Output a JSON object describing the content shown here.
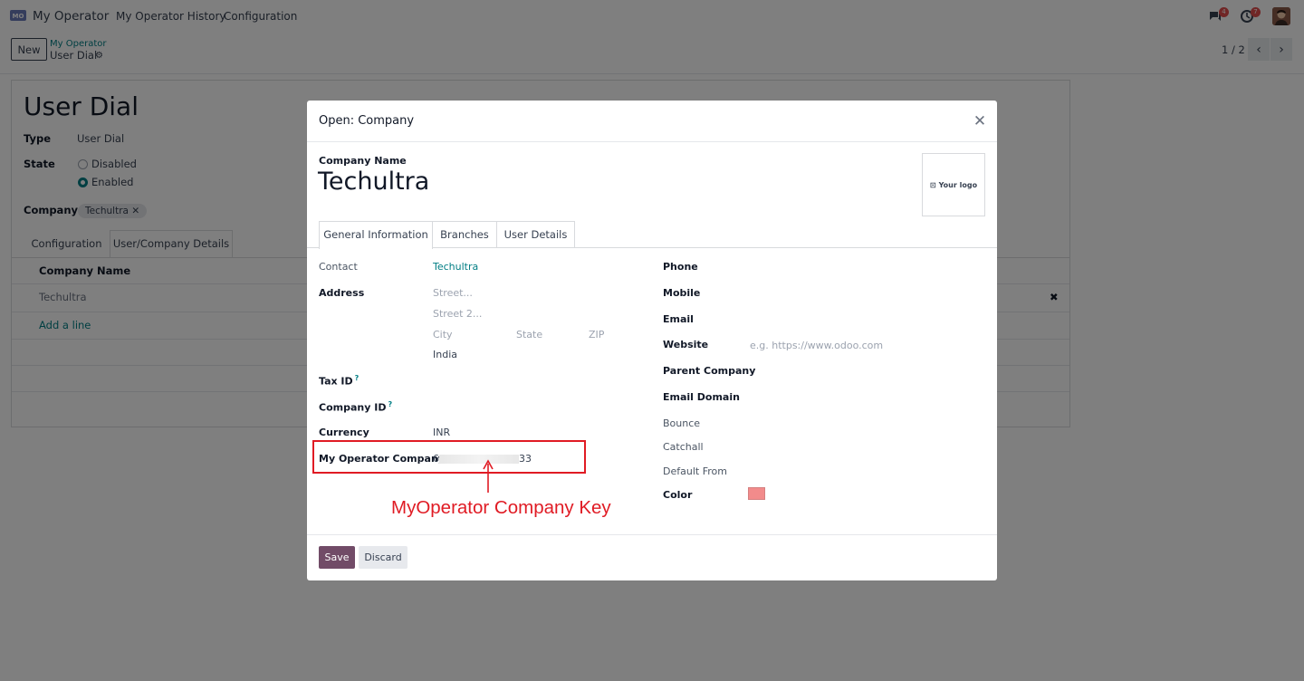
{
  "navbar": {
    "app_name": "My Operator",
    "menu": [
      "My Operator History",
      "Configuration"
    ],
    "messages_count": "4",
    "activities_count": "7"
  },
  "control_panel": {
    "new_label": "New",
    "breadcrumb_parent": "My Operator",
    "breadcrumb_current": "User Dial",
    "pager": "1 / 2"
  },
  "record": {
    "title": "User Dial",
    "type_label": "Type",
    "type_value": "User Dial",
    "state_label": "State",
    "state_options": [
      "Disabled",
      "Enabled"
    ],
    "state_selected": "Enabled",
    "company_label": "Company",
    "company_tag": "Techultra",
    "tabs": [
      "Configuration",
      "User/Company Details"
    ],
    "active_tab": "User/Company Details",
    "table_header": "Company Name",
    "table_rows": [
      "Techultra"
    ],
    "add_line": "Add a line"
  },
  "modal": {
    "title": "Open: Company",
    "company_name_label": "Company Name",
    "company_name": "Techultra",
    "logo_placeholder": "Your logo",
    "tabs": [
      "General Information",
      "Branches",
      "User Details"
    ],
    "active_tab": "General Information",
    "left": {
      "contact_label": "Contact",
      "contact_value": "Techultra",
      "address_label": "Address",
      "street_ph": "Street...",
      "street2_ph": "Street 2...",
      "city_ph": "City",
      "state_ph": "State",
      "zip_ph": "ZIP",
      "country": "India",
      "tax_id_label": "Tax ID",
      "company_id_label": "Company ID",
      "currency_label": "Currency",
      "currency_value": "INR",
      "myoperator_label": "My Operator Company",
      "myoperator_prefix": "6",
      "myoperator_suffix": "33"
    },
    "right": {
      "phone_label": "Phone",
      "mobile_label": "Mobile",
      "email_label": "Email",
      "website_label": "Website",
      "website_ph": "e.g. https://www.odoo.com",
      "parent_company_label": "Parent Company",
      "email_domain_label": "Email Domain",
      "bounce_label": "Bounce",
      "catchall_label": "Catchall",
      "default_from_label": "Default From",
      "color_label": "Color"
    },
    "annotation": "MyOperator Company Key",
    "save_label": "Save",
    "discard_label": "Discard"
  },
  "colors": {
    "primary": "#714b67",
    "link": "#017e84",
    "annotation": "#e01b24",
    "swatch": "#f28b8b"
  }
}
